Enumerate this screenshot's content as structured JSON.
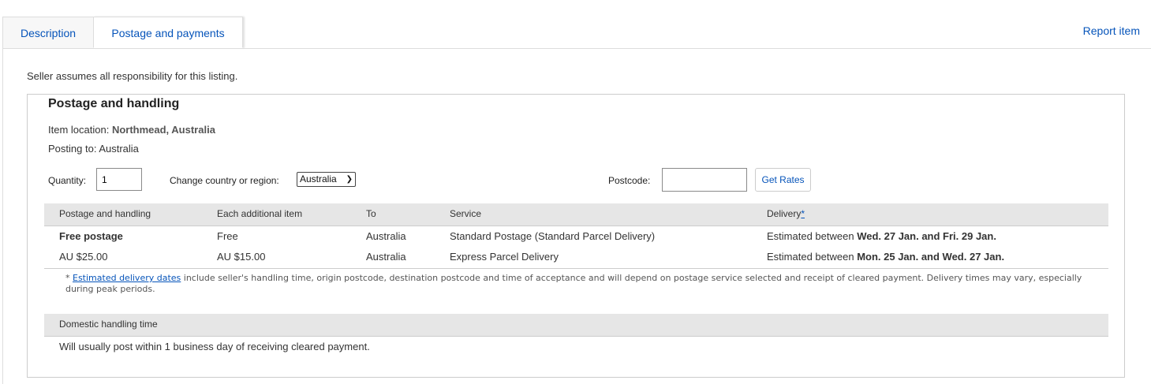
{
  "tabs": [
    {
      "label": "Description"
    },
    {
      "label": "Postage and payments",
      "active": true
    }
  ],
  "report_item": "Report item",
  "seller_note": "Seller assumes all responsibility for this listing.",
  "postage": {
    "title": "Postage and handling",
    "item_location_label": "Item location: ",
    "item_location_value": "Northmead, Australia",
    "posting_to": "Posting to: Australia",
    "quantity_label": "Quantity:",
    "quantity_value": "1",
    "country_label": "Change country or region:",
    "country_selected": "Australia",
    "postcode_label": "Postcode:",
    "postcode_value": "",
    "get_rates": "Get Rates"
  },
  "table": {
    "headers": [
      "Postage and handling",
      "Each additional item",
      "To",
      "Service",
      "Delivery"
    ],
    "delivery_star": "*",
    "rows": [
      {
        "cost": "Free postage",
        "additional": "Free",
        "to": "Australia",
        "service": "Standard Postage (Standard Parcel Delivery)",
        "delivery_prefix": "Estimated between ",
        "delivery_dates": "Wed. 27 Jan. and Fri. 29 Jan."
      },
      {
        "cost": "AU $25.00",
        "additional": "AU $15.00",
        "to": "Australia",
        "service": "Express Parcel Delivery",
        "delivery_prefix": "Estimated between ",
        "delivery_dates": "Mon. 25 Jan. and Wed. 27 Jan."
      }
    ]
  },
  "footnote": {
    "star": "* ",
    "link": "Estimated delivery dates",
    "text": " include seller's handling time, origin postcode, destination postcode and time of acceptance and will depend on postage service selected and receipt of cleared payment. Delivery times may vary, especially during peak periods."
  },
  "handling": {
    "title": "Domestic handling time",
    "text": "Will usually post within 1 business day of receiving cleared payment."
  },
  "colors": {
    "link": "#0654ba",
    "header_bg": "#e6e6e6"
  }
}
